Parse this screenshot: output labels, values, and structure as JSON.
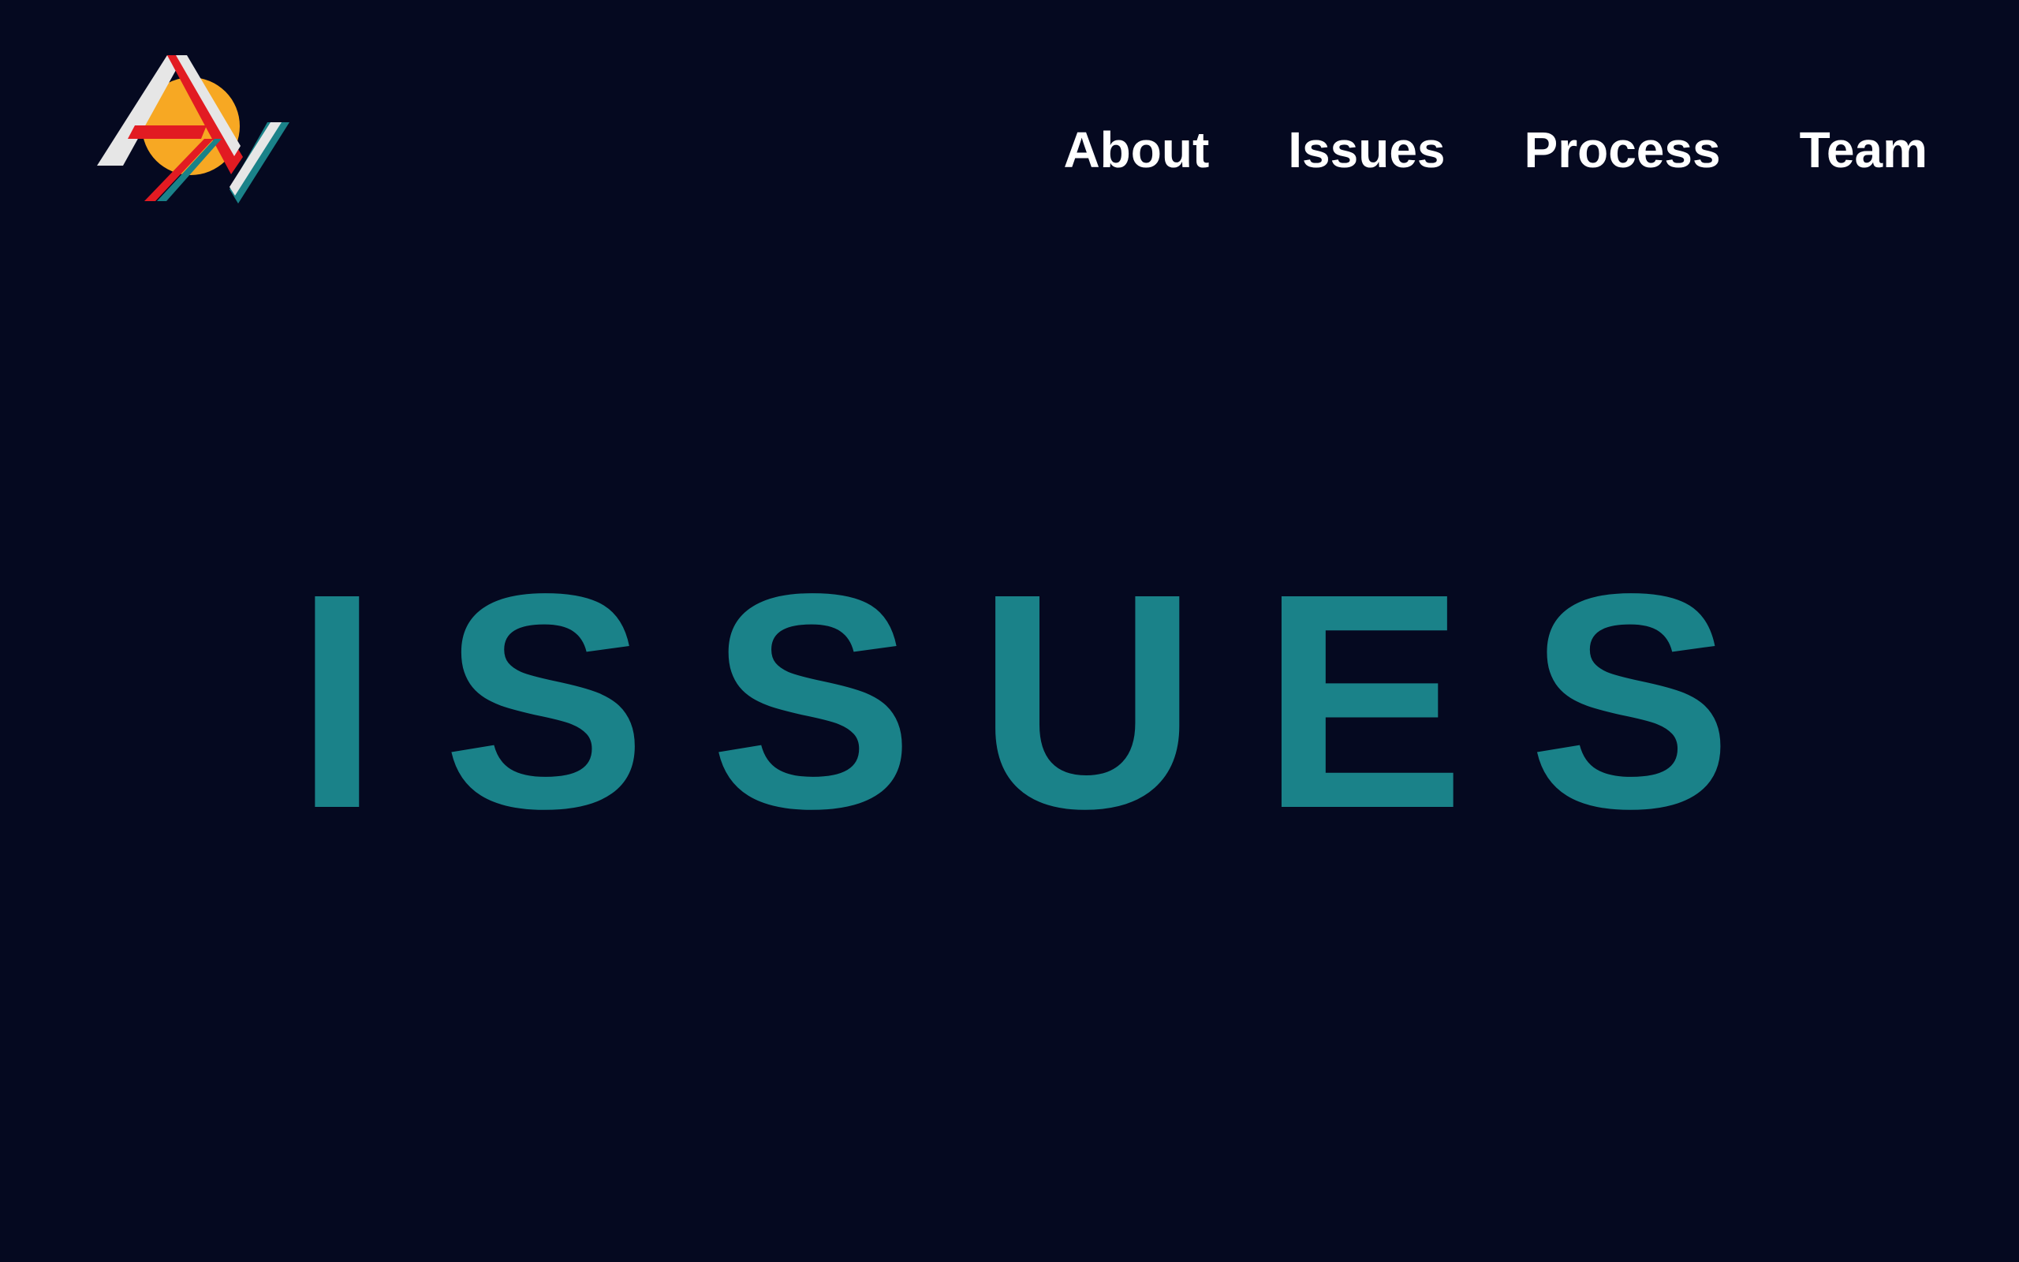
{
  "header": {
    "logo": {
      "name": "AV logo",
      "colors": {
        "sun": "#f7a823",
        "red": "#e21b22",
        "white": "#e6e6e6",
        "teal": "#1a8289"
      }
    },
    "nav": {
      "items": [
        {
          "label": "About"
        },
        {
          "label": "Issues"
        },
        {
          "label": "Process"
        },
        {
          "label": "Team"
        }
      ]
    }
  },
  "hero": {
    "title": "ISSUES"
  },
  "theme": {
    "background": "#050920",
    "nav_text": "#ffffff",
    "accent": "#1a8289"
  }
}
